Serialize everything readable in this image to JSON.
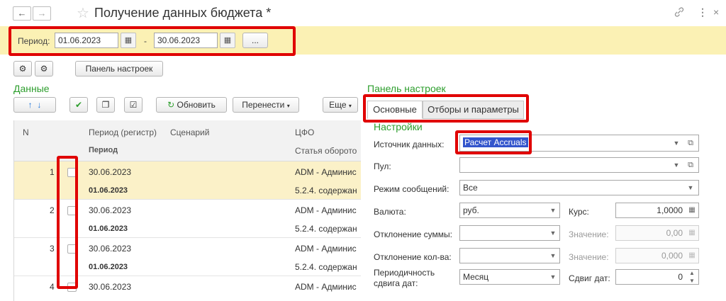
{
  "window": {
    "title": "Получение данных бюджета *",
    "back_icon": "←",
    "forward_icon": "→",
    "star_icon": "☆",
    "link_icon": "🔗",
    "more_icon": "⋮",
    "close_icon": "×"
  },
  "period": {
    "label": "Период:",
    "from": "01.06.2023",
    "dash": "-",
    "to": "30.06.2023",
    "more_label": "..."
  },
  "toolbar": {
    "settings_panel_button": "Панель настроек"
  },
  "data_section": {
    "title": "Данные",
    "refresh_label": "Обновить",
    "transfer_label": "Перенести",
    "more_label": "Еще"
  },
  "table": {
    "headers": {
      "n": "N",
      "period_register": "Период (регистр)",
      "scenario": "Сценарий",
      "cfo": "ЦФО",
      "period_sub": "Период",
      "cost_item": "Статья оборото"
    },
    "rows": [
      {
        "n": "1",
        "period_register": "30.06.2023",
        "period": "01.06.2023",
        "cfo": "ADM - Админис",
        "item": "5.2.4. содержан",
        "selected": true
      },
      {
        "n": "2",
        "period_register": "30.06.2023",
        "period": "01.06.2023",
        "cfo": "ADM - Админис",
        "item": "5.2.4. содержан",
        "selected": false
      },
      {
        "n": "3",
        "period_register": "30.06.2023",
        "period": "01.06.2023",
        "cfo": "ADM - Админис",
        "item": "5.2.4. содержан",
        "selected": false
      },
      {
        "n": "4",
        "period_register": "30.06.2023",
        "period": "",
        "cfo": "ADM - Админис",
        "item": "",
        "selected": false
      }
    ]
  },
  "settings_panel": {
    "title": "Панель настроек",
    "tabs": [
      "Основные",
      "Отборы и параметры"
    ],
    "section_title": "Настройки",
    "fields": {
      "source_label": "Источник данных:",
      "source_value": "Расчет Accruals",
      "pool_label": "Пул:",
      "pool_value": "",
      "messages_label": "Режим сообщений:",
      "messages_value": "Все",
      "currency_label": "Валюта:",
      "currency_value": "руб.",
      "rate_label": "Курс:",
      "rate_value": "1,0000",
      "sum_dev_label": "Отклонение суммы:",
      "sum_dev_value_label": "Значение:",
      "sum_dev_value": "0,00",
      "qty_dev_label": "Отклонение кол-ва:",
      "qty_dev_value_label": "Значение:",
      "qty_dev_value": "0,000",
      "periodicity_label_1": "Периодичность",
      "periodicity_label_2": "сдвига дат:",
      "periodicity_value": "Месяц",
      "shift_label": "Сдвиг дат:",
      "shift_value": "0"
    }
  },
  "colors": {
    "highlight_bar": "#fbf1b4",
    "annotation_red": "#e00000",
    "section_green": "#2d9e2d",
    "selected_row": "#fbf1c8"
  }
}
